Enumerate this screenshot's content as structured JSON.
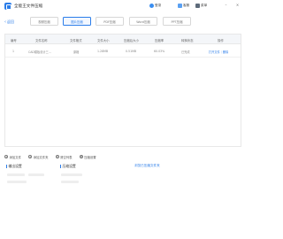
{
  "window": {
    "title": "全能王文件压缩",
    "actions": [
      {
        "icon": "user-icon",
        "label": "登录"
      },
      {
        "icon": "feedback-icon",
        "label": "客服"
      },
      {
        "icon": "menu-icon",
        "label": "菜单"
      }
    ],
    "controls": [
      "–",
      "×"
    ]
  },
  "nav": {
    "back_label": "返回"
  },
  "tabs": [
    {
      "label": "视频压缩",
      "active": false
    },
    {
      "label": "图片压缩",
      "active": true
    },
    {
      "label": "PDF压缩",
      "active": false
    },
    {
      "label": "Word压缩",
      "active": false
    },
    {
      "label": "PPT压缩",
      "active": false
    }
  ],
  "table": {
    "columns": [
      "编号",
      "文件名称",
      "文件格式",
      "文件大小",
      "压缩后大小",
      "压缩率",
      "转换状态",
      "操作"
    ],
    "rows": [
      {
        "index": "1",
        "name": "CAD模板设计三...",
        "format": "原格",
        "size": "1.28MB",
        "compressed": "0.51MB",
        "ratio": "60.03%",
        "status": "已完成",
        "action": "打开文件｜删除"
      }
    ]
  },
  "toolbar": [
    {
      "icon": "plus",
      "label": "添加文件"
    },
    {
      "icon": "plus",
      "label": "添加文件夹"
    },
    {
      "icon": "x",
      "label": "清空列表"
    },
    {
      "icon": "gear",
      "label": "压缩设置"
    }
  ],
  "sections": {
    "output_settings": "输出设置",
    "compress_settings": "压缩设置",
    "open_folder": "浏览已压缩文件夹"
  }
}
